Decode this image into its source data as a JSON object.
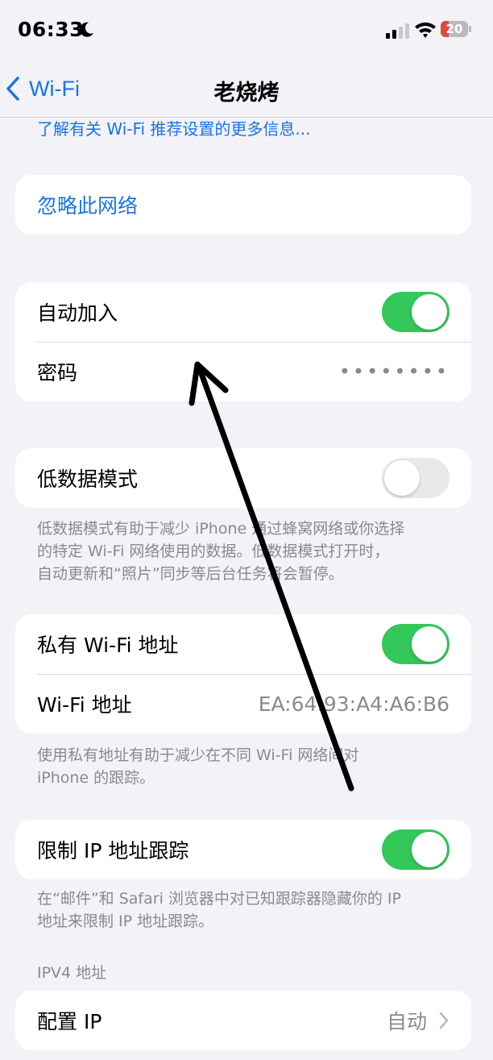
{
  "status_bar": {
    "time": "06:33",
    "battery_level": "20",
    "icons": [
      "moon-icon",
      "cellular-signal-icon",
      "wifi-icon",
      "battery-charging-icon"
    ]
  },
  "nav": {
    "back_label": "Wi-Fi",
    "title": "老烧烤"
  },
  "learn_more": "了解有关 Wi-Fi 推荐设置的更多信息...",
  "forget": {
    "label": "忽略此网络"
  },
  "auto_join": {
    "label": "自动加入",
    "on": true
  },
  "password": {
    "label": "密码",
    "value": "••••••••"
  },
  "low_data": {
    "label": "低数据模式",
    "on": false,
    "footnote_lines": [
      "低数据模式有助于减少 iPhone 通过蜂窝网络或你选择",
      "的特定 Wi-Fi 网络使用的数据。低数据模式打开时，",
      "自动更新和“照片”同步等后台任务将会暂停。"
    ]
  },
  "private_address": {
    "label": "私有 Wi-Fi 地址",
    "on": true,
    "wifi_address_label": "Wi-Fi 地址",
    "wifi_address_value": "EA:64:93:A4:A6:B6",
    "footnote_lines": [
      "使用私有地址有助于减少在不同 Wi-Fi 网络间对",
      "iPhone 的跟踪。"
    ]
  },
  "limit_ip": {
    "label": "限制 IP 地址跟踪",
    "on": true,
    "footnote_lines": [
      "在“邮件”和 Safari 浏览器中对已知跟踪器隐藏你的 IP",
      "地址来限制 IP 地址跟踪。"
    ]
  },
  "ipv4": {
    "header": "IPV4 地址",
    "configure_label": "配置 IP",
    "configure_value": "自动"
  },
  "colors": {
    "accent": "#1a73e8",
    "toggle_on": "#34c759",
    "background": "#f2f2f7"
  }
}
